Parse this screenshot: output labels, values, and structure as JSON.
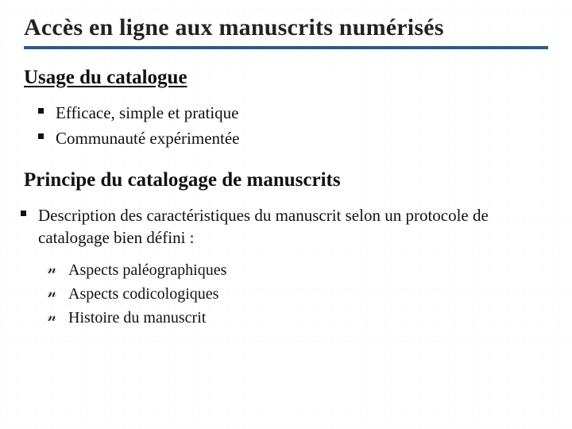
{
  "title": "Accès en ligne aux manuscrits numérisés",
  "section1": {
    "heading": "Usage du catalogue",
    "items": [
      "Efficace, simple et pratique",
      "Communauté expérimentée"
    ]
  },
  "section2": {
    "heading": "Principe du catalogage de manuscrits",
    "items": [
      "Description des caractéristiques du manuscrit selon un protocole de catalogage bien défini :"
    ],
    "subitems": [
      "Aspects paléographiques",
      "Aspects codicologiques",
      "Histoire du manuscrit"
    ]
  }
}
